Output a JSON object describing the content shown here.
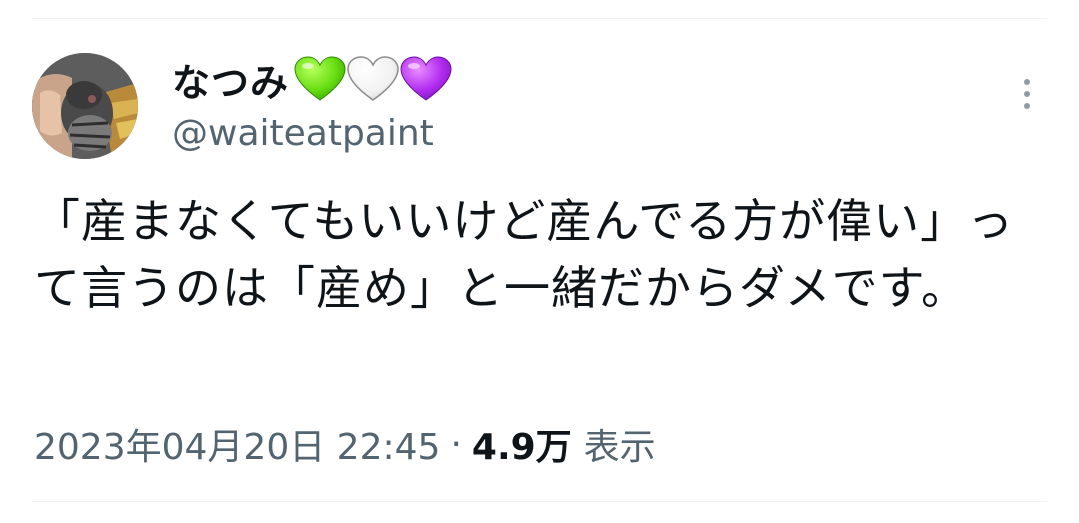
{
  "tweet": {
    "author": {
      "display_name": "なつみ",
      "handle": "@waiteatpaint",
      "name_hearts": [
        {
          "icon": "green-heart-icon",
          "color": "#66dd11"
        },
        {
          "icon": "white-heart-icon",
          "color": "#f4f4f4"
        },
        {
          "icon": "purple-heart-icon",
          "color": "#b12cf0"
        }
      ]
    },
    "text": "「産まなくてもいいけど産んでる方が偉い」って言うのは「産め」と一緒だからダメです。",
    "timestamp": "2023年04月20日 22:45",
    "separator": "·",
    "views_count": "4.9万",
    "views_label": "表示",
    "more_icon": "more-vertical-icon"
  },
  "colors": {
    "text_primary": "#0f1419",
    "text_secondary": "#536471",
    "divider": "#eff3f4"
  }
}
